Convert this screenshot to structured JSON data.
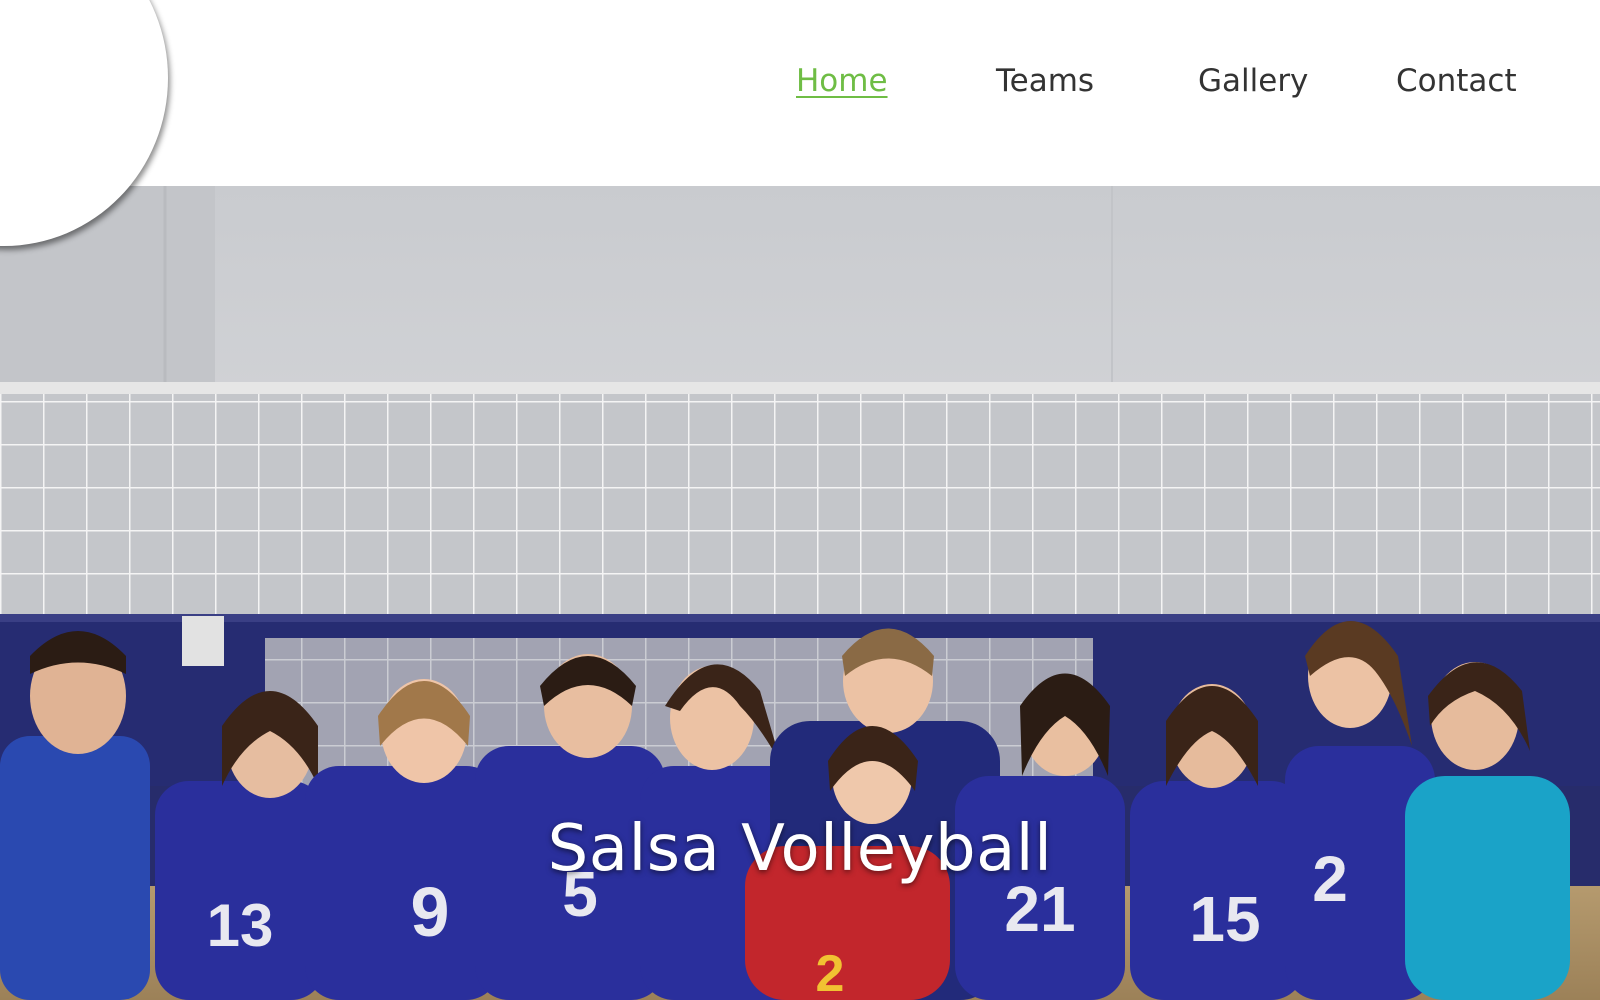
{
  "nav": {
    "items": [
      {
        "label": "Home",
        "active": true
      },
      {
        "label": "Teams",
        "active": false
      },
      {
        "label": "Gallery",
        "active": false
      },
      {
        "label": "Contact",
        "active": false
      }
    ],
    "active_color": "#6fbd45",
    "text_color": "#333333"
  },
  "hero": {
    "title": "Salsa Volleyball",
    "image_alt": "team-photo"
  },
  "colors": {
    "jersey_blue": "#2a2f9c",
    "wall_navy": "#262c72",
    "teal_shirt": "#1aa3c8",
    "red_jersey": "#c2262c"
  }
}
